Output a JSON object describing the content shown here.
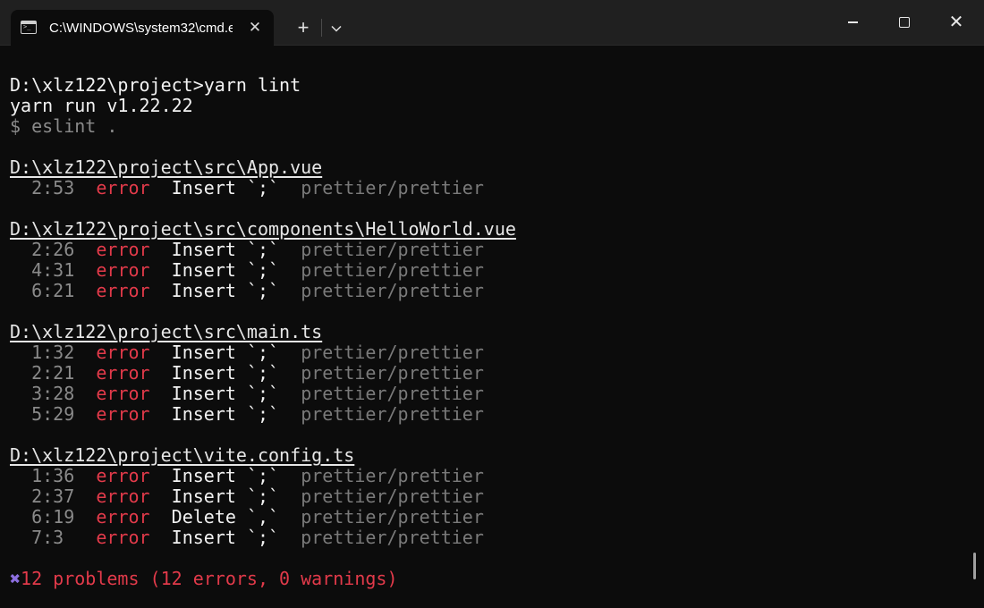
{
  "window": {
    "tab_title": "C:\\WINDOWS\\system32\\cmd.e",
    "tab_close": "✕",
    "new_tab": "+",
    "dropdown": "⌄",
    "close": "✕",
    "icons": {
      "tab": "terminal-icon",
      "minimize": "minimize-icon",
      "maximize": "maximize-icon",
      "close": "close-icon"
    }
  },
  "terminal": {
    "prompt": "D:\\xlz122\\project>yarn lint",
    "yarn_version": "yarn run v1.22.22",
    "command": "$ eslint .",
    "files": [
      {
        "path": "D:\\xlz122\\project\\src\\App.vue",
        "problems": [
          {
            "pos": "2:53",
            "severity": "error",
            "message": "Insert `;`",
            "rule": "prettier/prettier"
          }
        ]
      },
      {
        "path": "D:\\xlz122\\project\\src\\components\\HelloWorld.vue",
        "problems": [
          {
            "pos": "2:26",
            "severity": "error",
            "message": "Insert `;`",
            "rule": "prettier/prettier"
          },
          {
            "pos": "4:31",
            "severity": "error",
            "message": "Insert `;`",
            "rule": "prettier/prettier"
          },
          {
            "pos": "6:21",
            "severity": "error",
            "message": "Insert `;`",
            "rule": "prettier/prettier"
          }
        ]
      },
      {
        "path": "D:\\xlz122\\project\\src\\main.ts",
        "problems": [
          {
            "pos": "1:32",
            "severity": "error",
            "message": "Insert `;`",
            "rule": "prettier/prettier"
          },
          {
            "pos": "2:21",
            "severity": "error",
            "message": "Insert `;`",
            "rule": "prettier/prettier"
          },
          {
            "pos": "3:28",
            "severity": "error",
            "message": "Insert `;`",
            "rule": "prettier/prettier"
          },
          {
            "pos": "5:29",
            "severity": "error",
            "message": "Insert `;`",
            "rule": "prettier/prettier"
          }
        ]
      },
      {
        "path": "D:\\xlz122\\project\\vite.config.ts",
        "problems": [
          {
            "pos": "1:36",
            "severity": "error",
            "message": "Insert `;`",
            "rule": "prettier/prettier"
          },
          {
            "pos": "2:37",
            "severity": "error",
            "message": "Insert `;`",
            "rule": "prettier/prettier"
          },
          {
            "pos": "6:19",
            "severity": "error",
            "message": "Delete `,`",
            "rule": "prettier/prettier"
          },
          {
            "pos": "7:3",
            "severity": "error",
            "message": "Insert `;`",
            "rule": "prettier/prettier"
          }
        ]
      }
    ],
    "summary_icon": "✖",
    "summary": "12 problems (12 errors, 0 warnings)"
  },
  "colors": {
    "background": "#0c0c0c",
    "titlebar": "#202020",
    "error": "#e23a4a",
    "cross": "#8d6fe0",
    "dim": "#8a8a8a"
  }
}
